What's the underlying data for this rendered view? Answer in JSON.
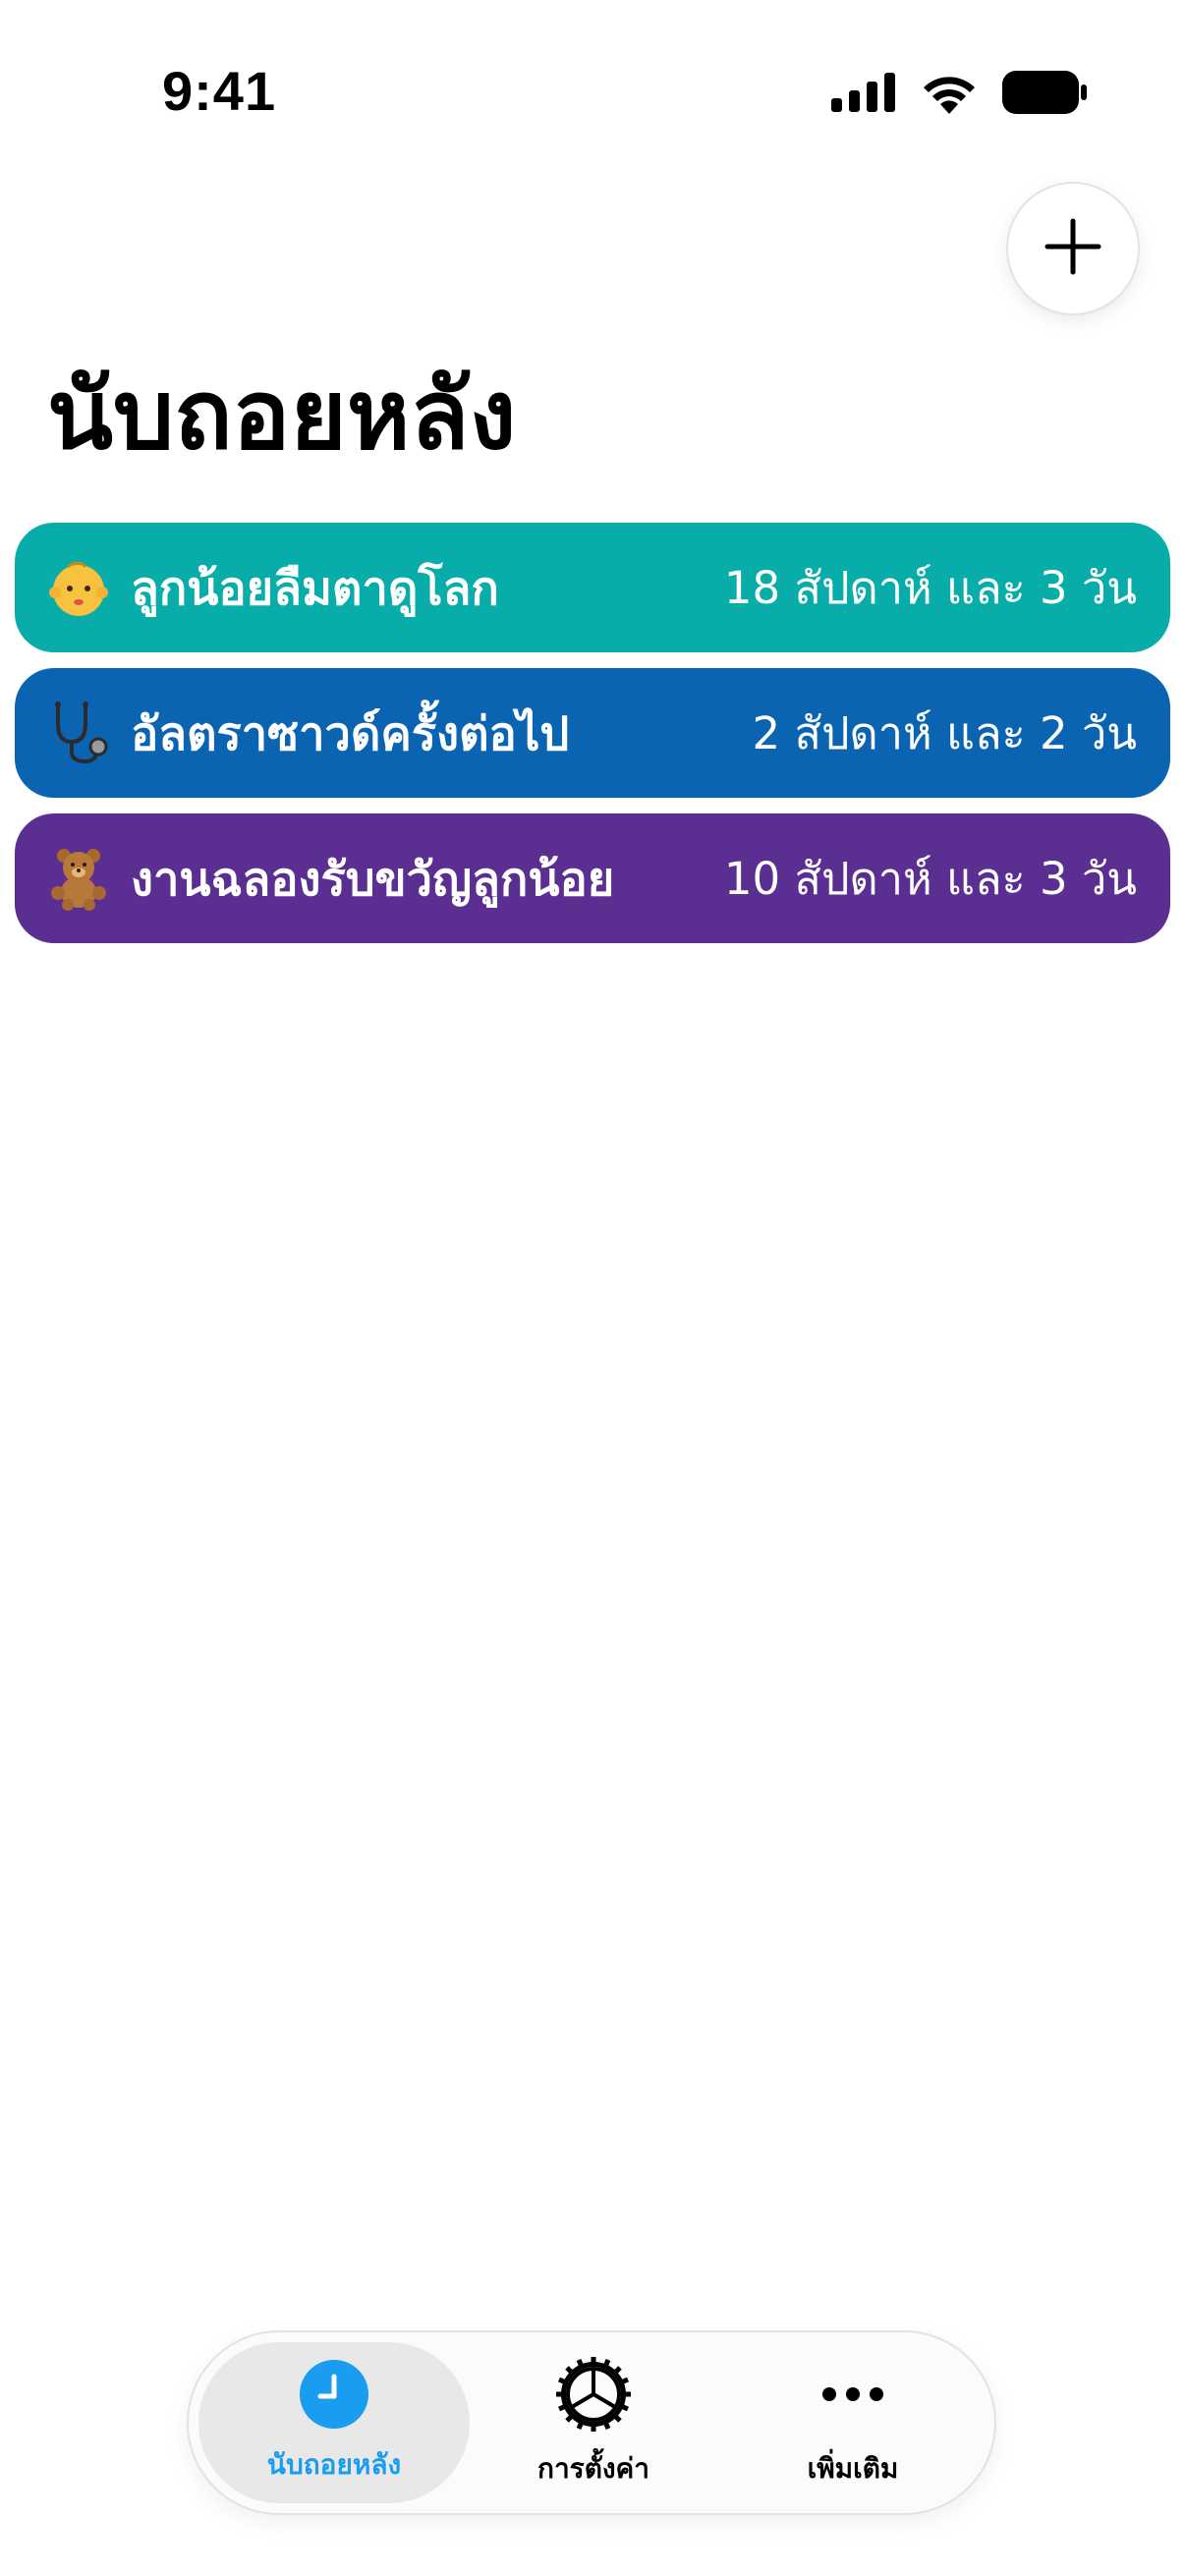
{
  "status_bar": {
    "time": "9:41",
    "icons": [
      "cellular-signal-icon",
      "wifi-icon",
      "battery-icon"
    ]
  },
  "header": {
    "add_button_icon": "plus-icon",
    "title": "นับถอยหลัง"
  },
  "countdowns": [
    {
      "emoji": "👶",
      "icon": "baby-icon",
      "name": "ลูกน้อยลืมตาดูโลก",
      "value": "18 สัปดาห์ และ 3 วัน",
      "color": "#08ADAA"
    },
    {
      "emoji": "🩺",
      "icon": "stethoscope-icon",
      "name": "อัลตราซาวด์ครั้งต่อไป",
      "value": "2 สัปดาห์ และ 2 วัน",
      "color": "#0A64B2"
    },
    {
      "emoji": "🧸",
      "icon": "teddy-bear-icon",
      "name": "งานฉลองรับขวัญลูกน้อย",
      "value": "10 สัปดาห์ และ 3 วัน",
      "color": "#5B2E92"
    }
  ],
  "tabbar": {
    "tabs": [
      {
        "label": "นับถอยหลัง",
        "icon": "clock-icon",
        "active": true
      },
      {
        "label": "การตั้งค่า",
        "icon": "gear-icon",
        "active": false
      },
      {
        "label": "เพิ่มเติม",
        "icon": "ellipsis-icon",
        "active": false
      }
    ],
    "accent": "#1A9CF0"
  }
}
